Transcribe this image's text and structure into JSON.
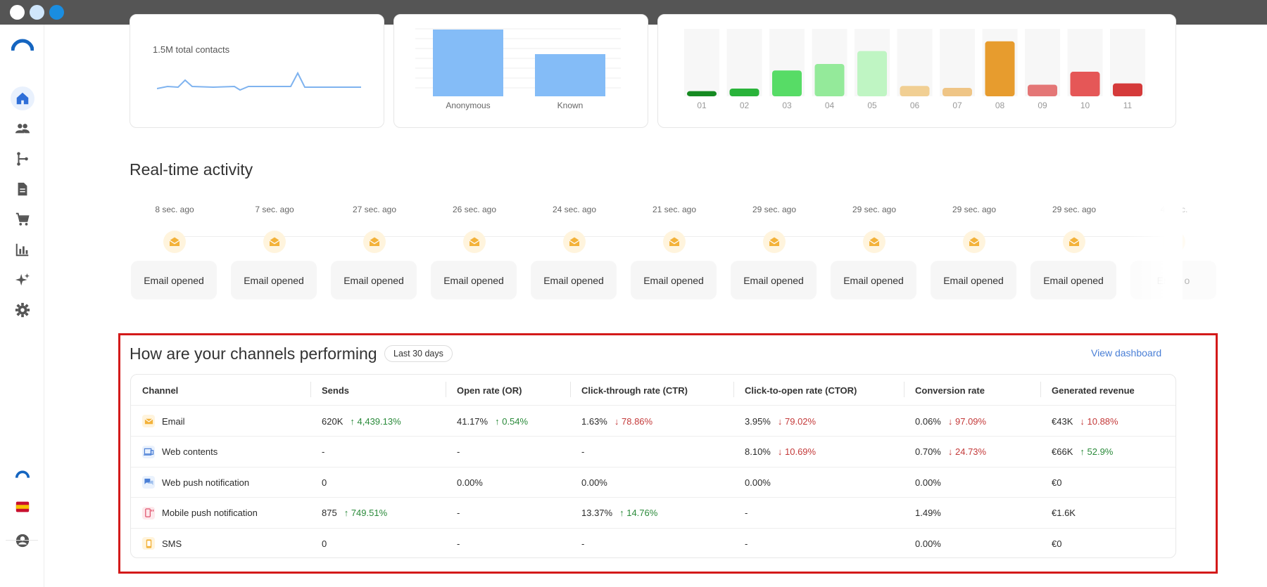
{
  "colors": {
    "accent": "#2f6fd8",
    "titlebar": "#555555",
    "red_box": "#d31a1a",
    "mail_icon": "#f3b23a"
  },
  "window_dots": [
    "#ffffff",
    "#cfe6fb",
    "#1a8de0"
  ],
  "sidebar": {
    "items": [
      {
        "icon": "home-icon",
        "active": true
      },
      {
        "icon": "people-icon"
      },
      {
        "icon": "flow-icon"
      },
      {
        "icon": "document-icon"
      },
      {
        "icon": "cart-icon"
      },
      {
        "icon": "bar-chart-icon"
      },
      {
        "icon": "sparkle-icon"
      },
      {
        "icon": "gear-icon"
      }
    ],
    "bottom": [
      {
        "icon": "brand-logo-icon"
      },
      {
        "icon": "spain-flag-icon"
      },
      {
        "icon": "account-icon"
      }
    ]
  },
  "top_cards": {
    "contacts": {
      "total_label": "1.5M total contacts"
    },
    "contact_types": {
      "categories": [
        "Anonymous",
        "Known"
      ],
      "values": [
        0.95,
        0.6
      ]
    },
    "rfm": {
      "categories": [
        "01",
        "02",
        "03",
        "04",
        "05",
        "06",
        "07",
        "08",
        "09",
        "10",
        "11"
      ],
      "values": [
        0.08,
        0.12,
        0.4,
        0.5,
        0.7,
        0.16,
        0.13,
        0.85,
        0.18,
        0.38,
        0.2
      ],
      "colors": [
        "#168a22",
        "#29b33a",
        "#57dc66",
        "#94ea9a",
        "#bff5c3",
        "#f1cf93",
        "#efc586",
        "#e79c2e",
        "#e47676",
        "#e55757",
        "#d53a3a"
      ]
    }
  },
  "realtime": {
    "title": "Real-time activity",
    "events": [
      {
        "time": "8 sec. ago",
        "label": "Email opened"
      },
      {
        "time": "7 sec. ago",
        "label": "Email opened"
      },
      {
        "time": "27 sec. ago",
        "label": "Email opened"
      },
      {
        "time": "26 sec. ago",
        "label": "Email opened"
      },
      {
        "time": "24 sec. ago",
        "label": "Email opened"
      },
      {
        "time": "21 sec. ago",
        "label": "Email opened"
      },
      {
        "time": "29 sec. ago",
        "label": "Email opened"
      },
      {
        "time": "29 sec. ago",
        "label": "Email opened"
      },
      {
        "time": "29 sec. ago",
        "label": "Email opened"
      },
      {
        "time": "29 sec. ago",
        "label": "Email opened"
      },
      {
        "time": "45 sec.",
        "label": "Email o"
      }
    ]
  },
  "channels": {
    "title": "How are your channels performing",
    "period": "Last 30 days",
    "view_dashboard": "View dashboard",
    "columns": [
      "Channel",
      "Sends",
      "Open rate (OR)",
      "Click-through rate (CTR)",
      "Click-to-open rate (CTOR)",
      "Conversion rate",
      "Generated revenue"
    ],
    "rows": [
      {
        "channel": "Email",
        "icon": "email-icon",
        "cells": [
          {
            "v": "620K",
            "d": "4,439.13%",
            "dir": "up"
          },
          {
            "v": "41.17%",
            "d": "0.54%",
            "dir": "up"
          },
          {
            "v": "1.63%",
            "d": "78.86%",
            "dir": "down"
          },
          {
            "v": "3.95%",
            "d": "79.02%",
            "dir": "down"
          },
          {
            "v": "0.06%",
            "d": "97.09%",
            "dir": "down"
          },
          {
            "v": "€43K",
            "d": "10.88%",
            "dir": "down"
          }
        ]
      },
      {
        "channel": "Web contents",
        "icon": "web-contents-icon",
        "cells": [
          {
            "v": "-"
          },
          {
            "v": "-"
          },
          {
            "v": "-"
          },
          {
            "v": "8.10%",
            "d": "10.69%",
            "dir": "down"
          },
          {
            "v": "0.70%",
            "d": "24.73%",
            "dir": "down"
          },
          {
            "v": "€66K",
            "d": "52.9%",
            "dir": "up"
          }
        ]
      },
      {
        "channel": "Web push notification",
        "icon": "web-push-icon",
        "cells": [
          {
            "v": "0"
          },
          {
            "v": "0.00%"
          },
          {
            "v": "0.00%"
          },
          {
            "v": "0.00%"
          },
          {
            "v": "0.00%"
          },
          {
            "v": "€0"
          }
        ]
      },
      {
        "channel": "Mobile push notification",
        "icon": "mobile-push-icon",
        "cells": [
          {
            "v": "875",
            "d": "749.51%",
            "dir": "up"
          },
          {
            "v": "-"
          },
          {
            "v": "13.37%",
            "d": "14.76%",
            "dir": "up"
          },
          {
            "v": "-"
          },
          {
            "v": "1.49%"
          },
          {
            "v": "€1.6K"
          }
        ]
      },
      {
        "channel": "SMS",
        "icon": "sms-icon",
        "cells": [
          {
            "v": "0"
          },
          {
            "v": "-"
          },
          {
            "v": "-"
          },
          {
            "v": "-"
          },
          {
            "v": "0.00%"
          },
          {
            "v": "€0"
          }
        ]
      }
    ]
  }
}
